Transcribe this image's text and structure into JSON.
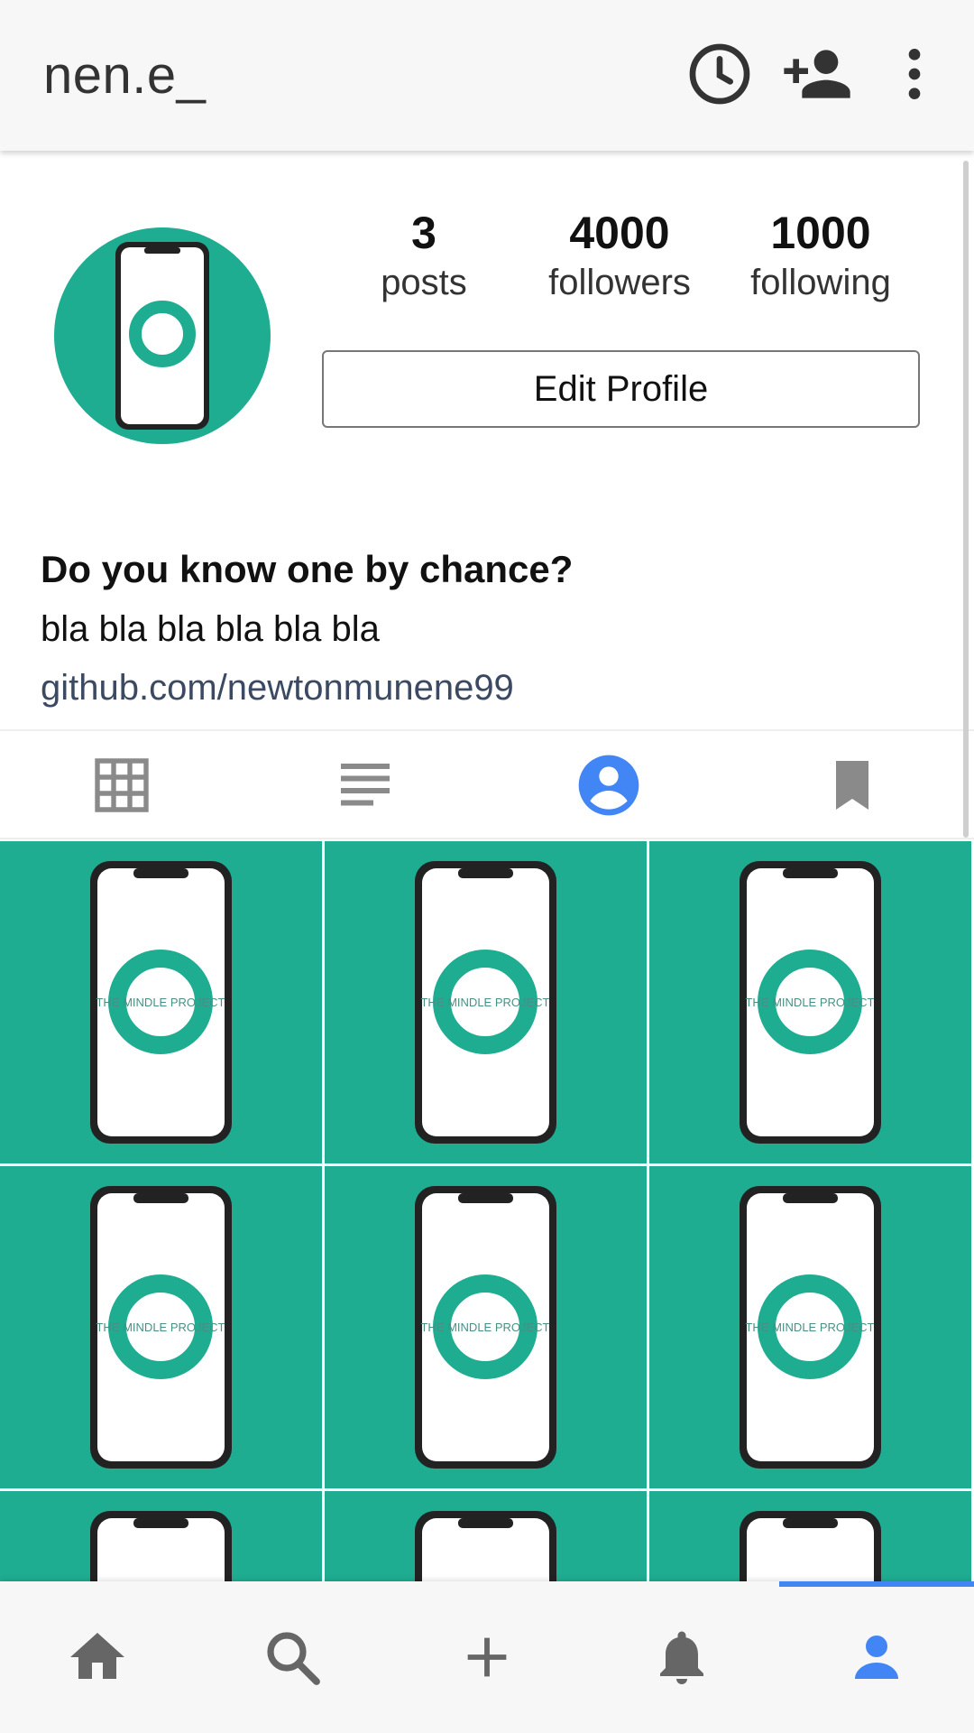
{
  "app_bar": {
    "username": "nen.e_",
    "icons": [
      "history-icon",
      "add-person-icon",
      "more-vert-icon"
    ]
  },
  "profile": {
    "stats": [
      {
        "value": "3",
        "label": "posts"
      },
      {
        "value": "4000",
        "label": "followers"
      },
      {
        "value": "1000",
        "label": "following"
      }
    ],
    "edit_button_label": "Edit Profile",
    "bio_name": "Do you know one by chance?",
    "bio_text": "bla bla bla bla bla bla",
    "bio_link": "github.com/newtonmunene99"
  },
  "tabs": {
    "items": [
      "grid-icon",
      "list-icon",
      "account-circle-icon",
      "bookmark-icon"
    ],
    "active_index": 2,
    "active_color": "#4285f4"
  },
  "posts": {
    "tile_color": "#1fad91",
    "image_text": "THE MINDLE PROJECT"
  },
  "bottom_nav": {
    "items": [
      "home-icon",
      "search-icon",
      "add-icon",
      "bell-icon",
      "person-icon"
    ],
    "active_index": 4,
    "active_color": "#4285f4"
  }
}
